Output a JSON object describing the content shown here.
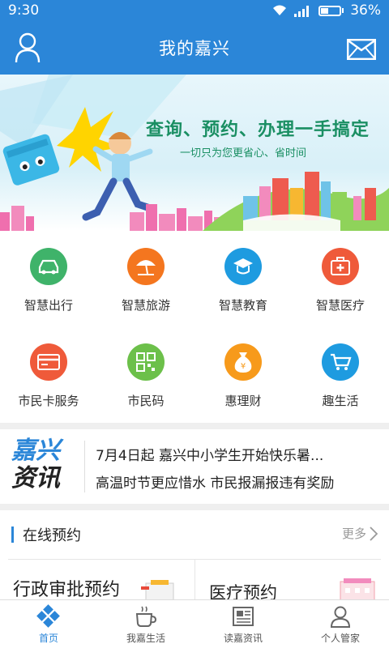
{
  "status_bar": {
    "time": "9:30",
    "battery": "36%",
    "battery_level": 0.36
  },
  "header": {
    "title": "我的嘉兴",
    "profile_icon": "user-icon",
    "mail_icon": "mail-icon"
  },
  "banner": {
    "headline": "查询、预约、办理一手搞定",
    "subline": "一切只为您更省心、省时间"
  },
  "services": [
    {
      "label": "智慧出行",
      "icon": "car-icon",
      "color": "#3fb36a"
    },
    {
      "label": "智慧旅游",
      "icon": "umbrella-icon",
      "color": "#f4761f"
    },
    {
      "label": "智慧教育",
      "icon": "graduation-cap-icon",
      "color": "#1e9be0"
    },
    {
      "label": "智慧医疗",
      "icon": "medical-kit-icon",
      "color": "#ef5a3a"
    },
    {
      "label": "市民卡服务",
      "icon": "card-icon",
      "color": "#ef5a3a"
    },
    {
      "label": "市民码",
      "icon": "qr-code-icon",
      "color": "#6cc04a"
    },
    {
      "label": "惠理财",
      "icon": "money-bag-icon",
      "color": "#f79a1b"
    },
    {
      "label": "趣生活",
      "icon": "cart-icon",
      "color": "#1e9be0"
    }
  ],
  "news": {
    "brand_line1": "嘉兴",
    "brand_line2": "资讯",
    "items": [
      "7月4日起 嘉兴中小学生开始快乐暑...",
      "高温时节更应惜水 市民报漏报违有奖励"
    ]
  },
  "booking": {
    "title": "在线预约",
    "more": "更多",
    "cards": [
      "行政审批预约",
      "医疗预约"
    ]
  },
  "tabs": [
    {
      "label": "首页",
      "icon": "home-diamond-icon",
      "active": true
    },
    {
      "label": "我嘉生活",
      "icon": "coffee-cup-icon",
      "active": false
    },
    {
      "label": "读嘉资讯",
      "icon": "newspaper-icon",
      "active": false
    },
    {
      "label": "个人管家",
      "icon": "person-icon",
      "active": false
    }
  ]
}
